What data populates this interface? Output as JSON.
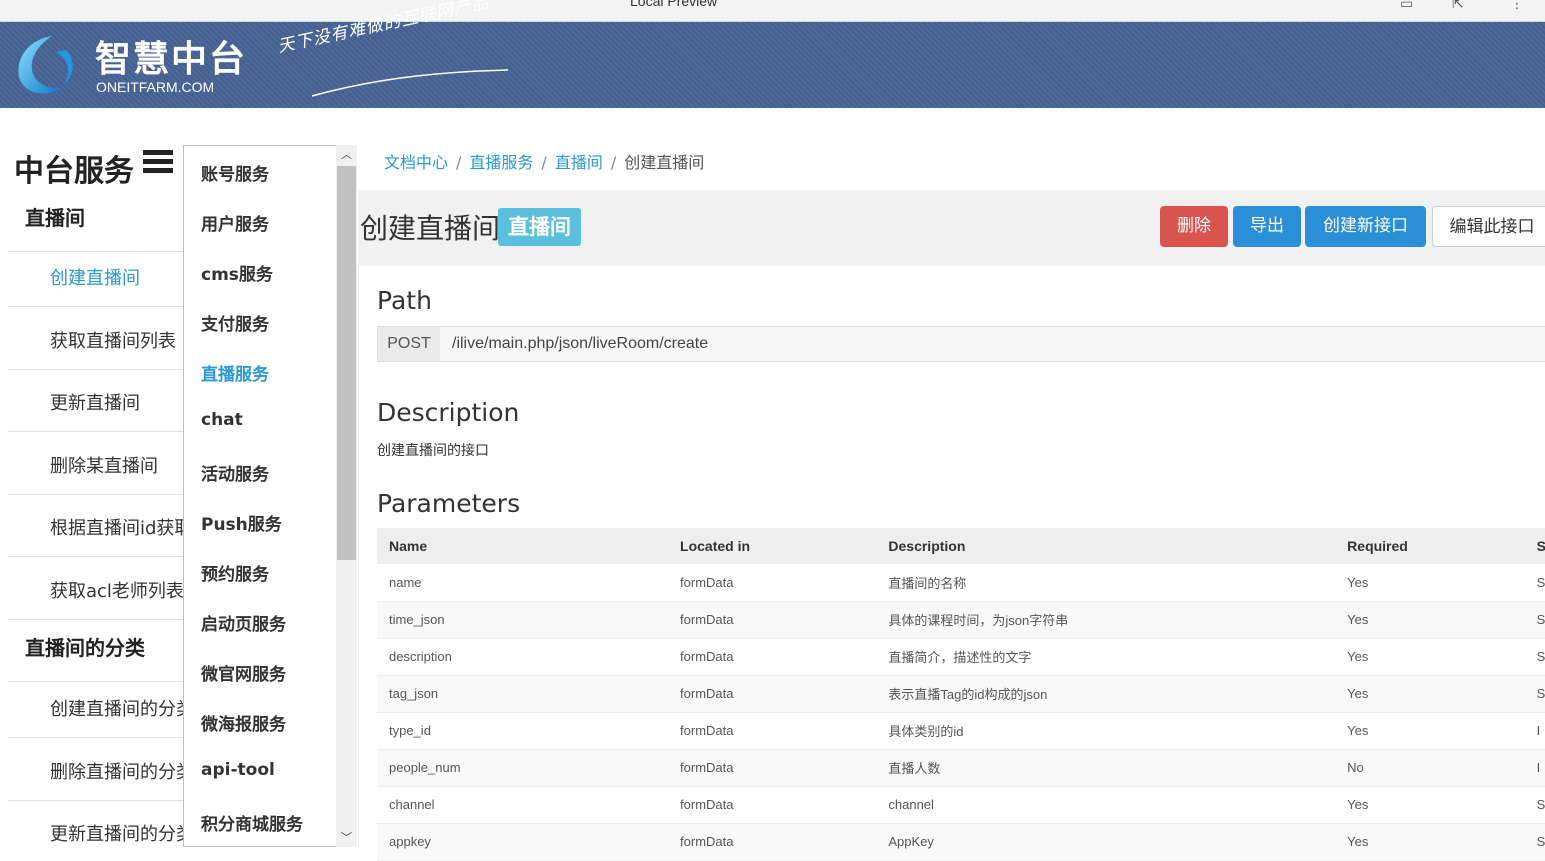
{
  "browser": {
    "title": "Local Preview"
  },
  "header": {
    "brand_cn": "智慧中台",
    "brand_en": "ONEITFARM.COM",
    "slogan": "天下没有难做的互联网产品"
  },
  "nav": {
    "title": "中台服务",
    "groups": [
      {
        "label": "直播间",
        "items": [
          "创建直播间",
          "获取直播间列表",
          "更新直播间",
          "删除某直播间",
          "根据直播间id获取",
          "获取acl老师列表"
        ]
      },
      {
        "label": "直播间的分类",
        "items": [
          "创建直播间的分类",
          "删除直播间的分类",
          "更新直播间的分类"
        ]
      }
    ]
  },
  "dropdown": {
    "items": [
      "账号服务",
      "用户服务",
      "cms服务",
      "支付服务",
      "直播服务",
      "chat",
      "活动服务",
      "Push服务",
      "预约服务",
      "启动页服务",
      "微官网服务",
      "微海报服务",
      "api-tool",
      "积分商城服务"
    ],
    "active_index": 4
  },
  "breadcrumb": {
    "items": [
      "文档中心",
      "直播服务",
      "直播间"
    ],
    "current": "创建直播间"
  },
  "titlebar": {
    "title": "创建直播间",
    "badge": "直播间",
    "btn_delete": "删除",
    "btn_export": "导出",
    "btn_create": "创建新接口",
    "btn_edit": "编辑此接口"
  },
  "path": {
    "heading": "Path",
    "method": "POST",
    "url": "/ilive/main.php/json/liveRoom/create"
  },
  "description": {
    "heading": "Description",
    "text": "创建直播间的接口"
  },
  "parameters": {
    "heading": "Parameters",
    "columns": [
      "Name",
      "Located in",
      "Description",
      "Required",
      "S"
    ],
    "rows": [
      [
        "name",
        "formData",
        "直播间的名称",
        "Yes",
        "S"
      ],
      [
        "time_json",
        "formData",
        "具体的课程时间，为json字符串",
        "Yes",
        "S"
      ],
      [
        "description",
        "formData",
        "直播简介，描述性的文字",
        "Yes",
        "S"
      ],
      [
        "tag_json",
        "formData",
        "表示直播Tag的id构成的json",
        "Yes",
        "S"
      ],
      [
        "type_id",
        "formData",
        "具体类别的id",
        "Yes",
        "I"
      ],
      [
        "people_num",
        "formData",
        "直播人数",
        "No",
        "I"
      ],
      [
        "channel",
        "formData",
        "channel",
        "Yes",
        "S"
      ],
      [
        "appkey",
        "formData",
        "AppKey",
        "Yes",
        "S"
      ]
    ]
  },
  "colors": {
    "accent": "#2a98d6",
    "danger": "#d9534f",
    "badge": "#5bc0de",
    "banner": "#4d699a"
  }
}
